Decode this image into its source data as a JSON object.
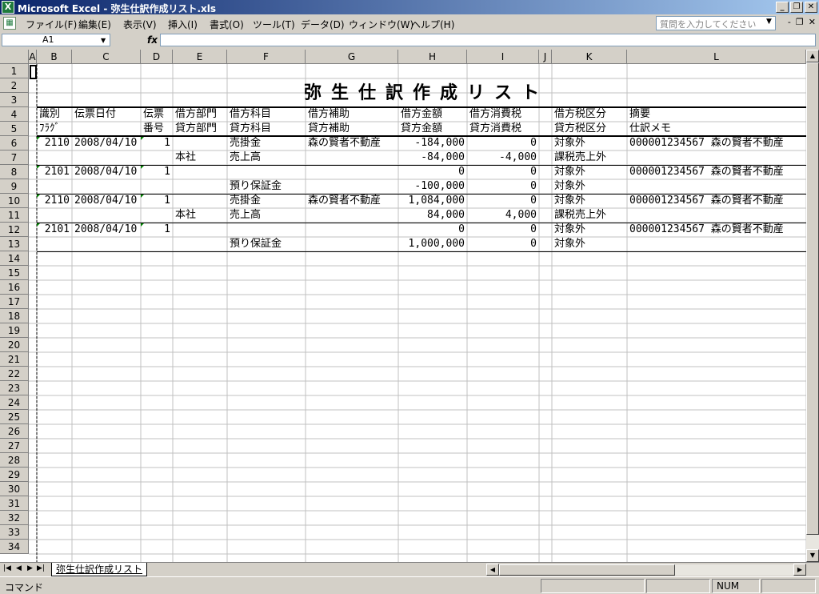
{
  "window": {
    "title": "Microsoft Excel - 弥生仕訳作成リスト.xls",
    "app_icon": "excel-icon",
    "buttons": [
      "_",
      "❐",
      "✕"
    ]
  },
  "menu": [
    "ファイル(F)",
    "編集(E)",
    "表示(V)",
    "挿入(I)",
    "書式(O)",
    "ツール(T)",
    "データ(D)",
    "ウィンドウ(W)",
    "ヘルプ(H)"
  ],
  "help_box": {
    "placeholder": "質問を入力してください"
  },
  "mdi_buttons": [
    "-",
    "❐",
    "✕"
  ],
  "formula_bar": {
    "name_box": "A1",
    "fx": "fx",
    "formula": ""
  },
  "columns": [
    "A",
    "B",
    "C",
    "D",
    "E",
    "F",
    "G",
    "H",
    "I",
    "J",
    "K",
    "L"
  ],
  "rows": [
    "1",
    "2",
    "3",
    "4",
    "5",
    "6",
    "7",
    "8",
    "9",
    "10",
    "11",
    "12",
    "13",
    "14",
    "15",
    "16",
    "17",
    "18",
    "19",
    "20",
    "21",
    "22",
    "23",
    "24",
    "25",
    "26",
    "27",
    "28",
    "29",
    "30",
    "31",
    "32",
    "33",
    "34"
  ],
  "sheet": {
    "title": "弥生仕訳作成リスト",
    "header_row4": [
      "識別",
      "伝票日付",
      "伝票",
      "借方部門",
      "借方科目",
      "借方補助",
      "借方金額",
      "借方消費税",
      "",
      "借方税区分",
      "摘要"
    ],
    "header_row5": [
      "ﾌﾗｸﾞ",
      "",
      "番号",
      "貸方部門",
      "貸方科目",
      "貸方補助",
      "貸方金額",
      "貸方消費税",
      "",
      "貸方税区分",
      "仕訳メモ"
    ],
    "data": [
      [
        "2110",
        "2008/04/10",
        "1",
        "",
        "売掛金",
        "森の賢者不動産",
        "-184,000",
        "0",
        "",
        "対象外",
        "000001234567 森の賢者不動産"
      ],
      [
        "",
        "",
        "",
        "本社",
        "売上高",
        "",
        "-84,000",
        "-4,000",
        "",
        "課税売上外",
        ""
      ],
      [
        "2101",
        "2008/04/10",
        "1",
        "",
        "",
        "",
        "0",
        "0",
        "",
        "対象外",
        "000001234567 森の賢者不動産"
      ],
      [
        "",
        "",
        "",
        "",
        "預り保証金",
        "",
        "-100,000",
        "0",
        "",
        "対象外",
        ""
      ],
      [
        "2110",
        "2008/04/10",
        "1",
        "",
        "売掛金",
        "森の賢者不動産",
        "1,084,000",
        "0",
        "",
        "対象外",
        "000001234567 森の賢者不動産"
      ],
      [
        "",
        "",
        "",
        "本社",
        "売上高",
        "",
        "84,000",
        "4,000",
        "",
        "課税売上外",
        ""
      ],
      [
        "2101",
        "2008/04/10",
        "1",
        "",
        "",
        "",
        "0",
        "0",
        "",
        "対象外",
        "000001234567 森の賢者不動産"
      ],
      [
        "",
        "",
        "",
        "",
        "預り保証金",
        "",
        "1,000,000",
        "0",
        "",
        "対象外",
        ""
      ]
    ]
  },
  "tab": {
    "name": "弥生仕訳作成リスト",
    "nav": [
      "|◀",
      "◀",
      "▶",
      "▶|"
    ]
  },
  "status": {
    "left": "コマンド",
    "num": "NUM"
  }
}
